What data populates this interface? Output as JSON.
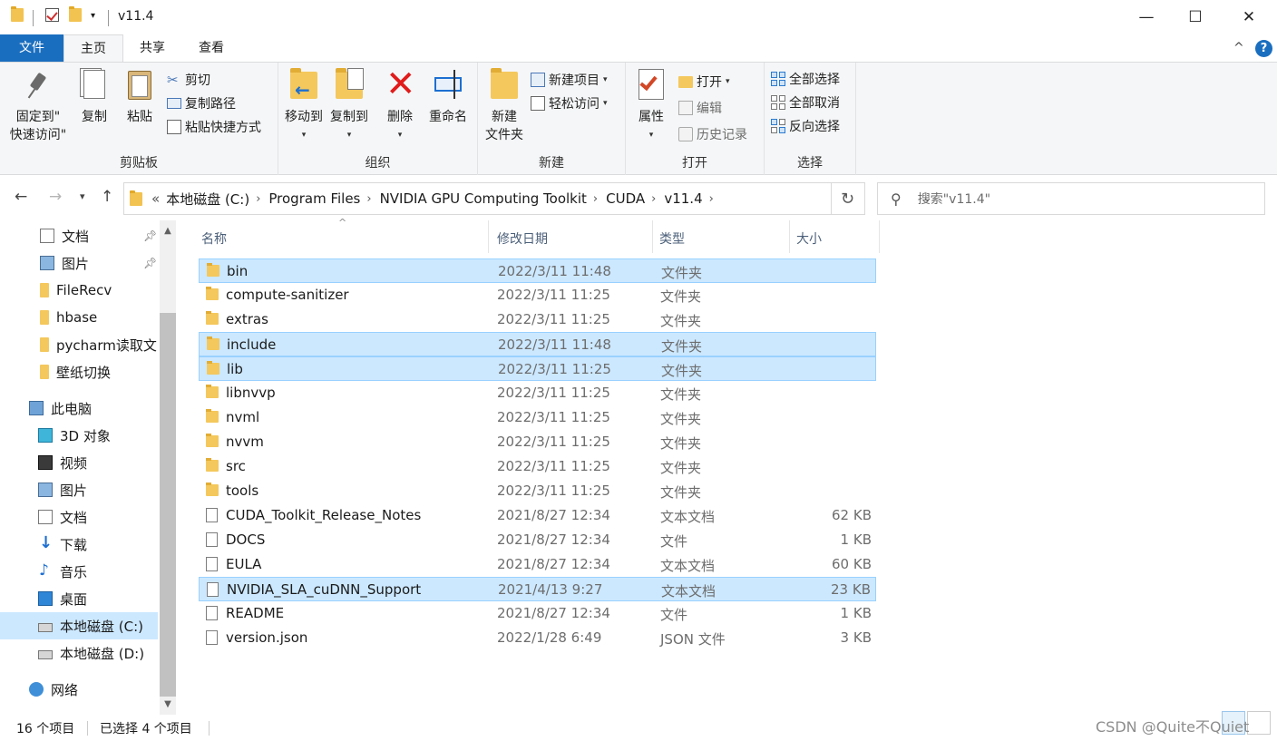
{
  "window": {
    "title": "v11.4",
    "minimize": "—",
    "maximize": "☐",
    "close": "✕"
  },
  "ribbon_tabs": {
    "file": "文件",
    "home": "主页",
    "share": "共享",
    "view": "查看",
    "collapse": "^",
    "help": "?"
  },
  "clipboard": {
    "pin_label_1": "固定到\"",
    "pin_label_2": "快速访问\"",
    "copy": "复制",
    "paste": "粘贴",
    "cut": "剪切",
    "copy_path": "复制路径",
    "paste_shortcut": "粘贴快捷方式",
    "group": "剪贴板"
  },
  "organize": {
    "move_to": "移动到",
    "copy_to": "复制到",
    "delete": "删除",
    "rename": "重命名",
    "group": "组织"
  },
  "new": {
    "new_folder_1": "新建",
    "new_folder_2": "文件夹",
    "new_item": "新建项目",
    "easy_access": "轻松访问",
    "group": "新建"
  },
  "open": {
    "properties": "属性",
    "open": "打开",
    "edit": "编辑",
    "history": "历史记录",
    "group": "打开"
  },
  "select": {
    "select_all": "全部选择",
    "select_none": "全部取消",
    "invert": "反向选择",
    "group": "选择"
  },
  "address": {
    "overflow": "«",
    "crumbs": [
      "本地磁盘 (C:)",
      "Program Files",
      "NVIDIA GPU Computing Toolkit",
      "CUDA",
      "v11.4"
    ],
    "search_placeholder": "搜索\"v11.4\""
  },
  "nav_pane": {
    "items": [
      {
        "label": "文档",
        "icon": "document-icon",
        "pinned": true
      },
      {
        "label": "图片",
        "icon": "picture-icon",
        "pinned": true
      },
      {
        "label": "FileRecv",
        "icon": "folder-icon"
      },
      {
        "label": "hbase",
        "icon": "folder-icon"
      },
      {
        "label": "pycharm读取文",
        "icon": "folder-icon"
      },
      {
        "label": "壁纸切换",
        "icon": "folder-icon"
      },
      {
        "label": "此电脑",
        "icon": "computer-icon"
      },
      {
        "label": "3D 对象",
        "icon": "3d-objects-icon"
      },
      {
        "label": "视频",
        "icon": "video-icon"
      },
      {
        "label": "图片",
        "icon": "picture-icon"
      },
      {
        "label": "文档",
        "icon": "document-icon"
      },
      {
        "label": "下载",
        "icon": "download-icon"
      },
      {
        "label": "音乐",
        "icon": "music-icon"
      },
      {
        "label": "桌面",
        "icon": "desktop-icon"
      },
      {
        "label": "本地磁盘 (C:)",
        "icon": "drive-icon",
        "selected": true
      },
      {
        "label": "本地磁盘 (D:)",
        "icon": "drive-icon"
      },
      {
        "label": "网络",
        "icon": "network-icon"
      }
    ]
  },
  "file_list": {
    "columns": {
      "name": "名称",
      "date": "修改日期",
      "type": "类型",
      "size": "大小"
    },
    "rows": [
      {
        "name": "bin",
        "date": "2022/3/11 11:48",
        "type": "文件夹",
        "size": "",
        "kind": "folder",
        "selected": true
      },
      {
        "name": "compute-sanitizer",
        "date": "2022/3/11 11:25",
        "type": "文件夹",
        "size": "",
        "kind": "folder"
      },
      {
        "name": "extras",
        "date": "2022/3/11 11:25",
        "type": "文件夹",
        "size": "",
        "kind": "folder"
      },
      {
        "name": "include",
        "date": "2022/3/11 11:48",
        "type": "文件夹",
        "size": "",
        "kind": "folder",
        "selected": true
      },
      {
        "name": "lib",
        "date": "2022/3/11 11:25",
        "type": "文件夹",
        "size": "",
        "kind": "folder",
        "selected": true
      },
      {
        "name": "libnvvp",
        "date": "2022/3/11 11:25",
        "type": "文件夹",
        "size": "",
        "kind": "folder"
      },
      {
        "name": "nvml",
        "date": "2022/3/11 11:25",
        "type": "文件夹",
        "size": "",
        "kind": "folder"
      },
      {
        "name": "nvvm",
        "date": "2022/3/11 11:25",
        "type": "文件夹",
        "size": "",
        "kind": "folder"
      },
      {
        "name": "src",
        "date": "2022/3/11 11:25",
        "type": "文件夹",
        "size": "",
        "kind": "folder"
      },
      {
        "name": "tools",
        "date": "2022/3/11 11:25",
        "type": "文件夹",
        "size": "",
        "kind": "folder"
      },
      {
        "name": "CUDA_Toolkit_Release_Notes",
        "date": "2021/8/27 12:34",
        "type": "文本文档",
        "size": "62 KB",
        "kind": "file"
      },
      {
        "name": "DOCS",
        "date": "2021/8/27 12:34",
        "type": "文件",
        "size": "1 KB",
        "kind": "file"
      },
      {
        "name": "EULA",
        "date": "2021/8/27 12:34",
        "type": "文本文档",
        "size": "60 KB",
        "kind": "file"
      },
      {
        "name": "NVIDIA_SLA_cuDNN_Support",
        "date": "2021/4/13 9:27",
        "type": "文本文档",
        "size": "23 KB",
        "kind": "file",
        "selected": true
      },
      {
        "name": "README",
        "date": "2021/8/27 12:34",
        "type": "文件",
        "size": "1 KB",
        "kind": "file"
      },
      {
        "name": "version.json",
        "date": "2022/1/28 6:49",
        "type": "JSON 文件",
        "size": "3 KB",
        "kind": "file"
      }
    ]
  },
  "status": {
    "count": "16 个项目",
    "selected": "已选择 4 个项目",
    "watermark": "CSDN @Quite不Quiet"
  },
  "colors": {
    "accent": "#1a6ebf",
    "selection": "#cce8ff",
    "folder": "#f4c85d"
  }
}
